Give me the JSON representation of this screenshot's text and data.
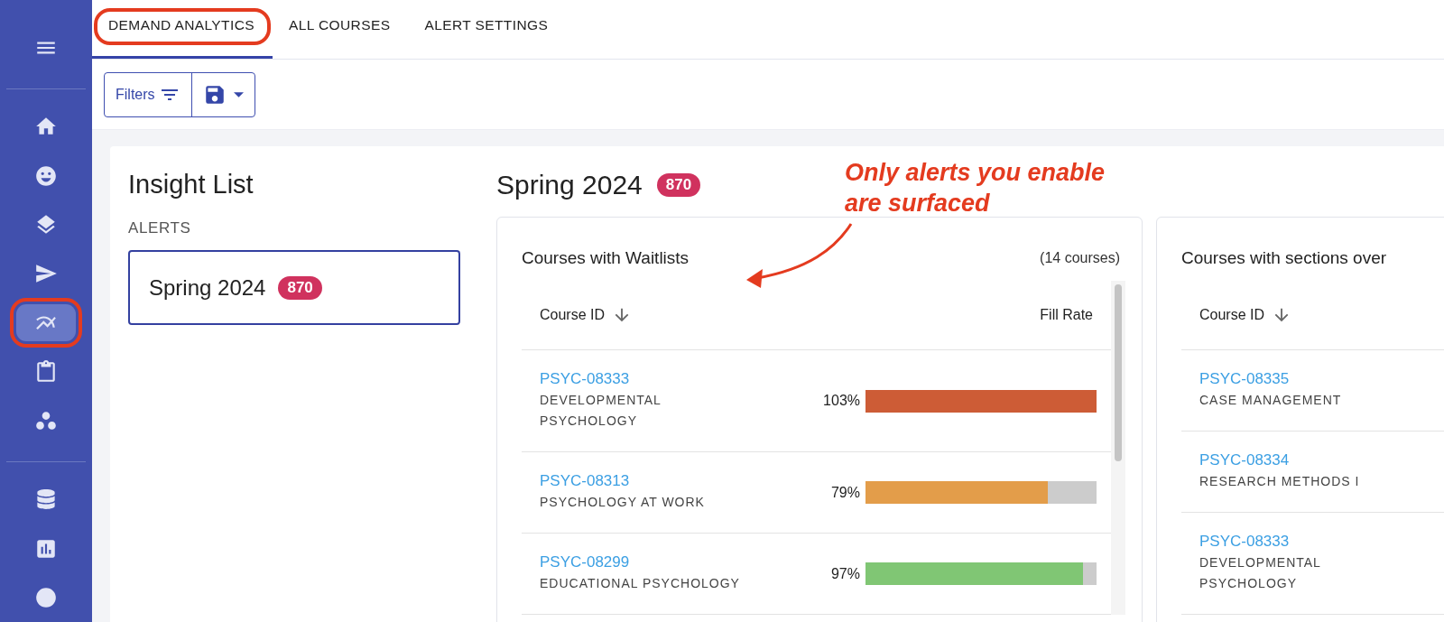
{
  "sidebar": {
    "items": [
      {
        "kind": "menu",
        "selected": false,
        "circled": false
      },
      {
        "kind": "home",
        "selected": false,
        "circled": false
      },
      {
        "kind": "face",
        "selected": false,
        "circled": false
      },
      {
        "kind": "layers",
        "selected": false,
        "circled": false
      },
      {
        "kind": "send",
        "selected": false,
        "circled": false
      },
      {
        "kind": "trend",
        "selected": true,
        "circled": true
      },
      {
        "kind": "clipboard",
        "selected": false,
        "circled": false
      },
      {
        "kind": "dots",
        "selected": false,
        "circled": false
      },
      {
        "kind": "database",
        "selected": false,
        "circled": false
      },
      {
        "kind": "chart",
        "selected": false,
        "circled": false
      },
      {
        "kind": "circle",
        "selected": false,
        "circled": false
      }
    ]
  },
  "tabs": [
    {
      "label": "DEMAND ANALYTICS",
      "selected": true,
      "circled": true
    },
    {
      "label": "ALL COURSES",
      "selected": false,
      "circled": false
    },
    {
      "label": "ALERT SETTINGS",
      "selected": false,
      "circled": false
    }
  ],
  "toolbar": {
    "filters_label": "Filters"
  },
  "insight_list": {
    "title": "Insight List",
    "section": "ALERTS",
    "items": [
      {
        "label": "Spring 2024",
        "count": "870",
        "selected": true
      }
    ]
  },
  "main": {
    "title": "Spring 2024",
    "count": "870",
    "callout": "Only alerts you enable are surfaced",
    "cards": [
      {
        "title": "Courses with Waitlists",
        "count_label": "(14 courses)",
        "columns": [
          "Course ID",
          "Fill Rate"
        ],
        "rows": [
          {
            "id": "PSYC-08333",
            "name": "DEVELOPMENTAL PSYCHOLOGY",
            "percent": "103%",
            "level": 1,
            "color": "#cd5c36"
          },
          {
            "id": "PSYC-08313",
            "name": "PSYCHOLOGY AT WORK",
            "percent": "79%",
            "level": 0.79,
            "color": "#e39d4a"
          },
          {
            "id": "PSYC-08299",
            "name": "EDUCATIONAL PSYCHOLOGY",
            "percent": "97%",
            "level": 0.94,
            "color": "#80c674"
          }
        ]
      },
      {
        "title": "Courses with sections over",
        "columns": [
          "Course ID"
        ],
        "rows": [
          {
            "id": "PSYC-08335",
            "name": "CASE MANAGEMENT"
          },
          {
            "id": "PSYC-08334",
            "name": "RESEARCH METHODS I"
          },
          {
            "id": "PSYC-08333",
            "name": "DEVELOPMENTAL PSYCHOLOGY"
          }
        ]
      }
    ]
  }
}
